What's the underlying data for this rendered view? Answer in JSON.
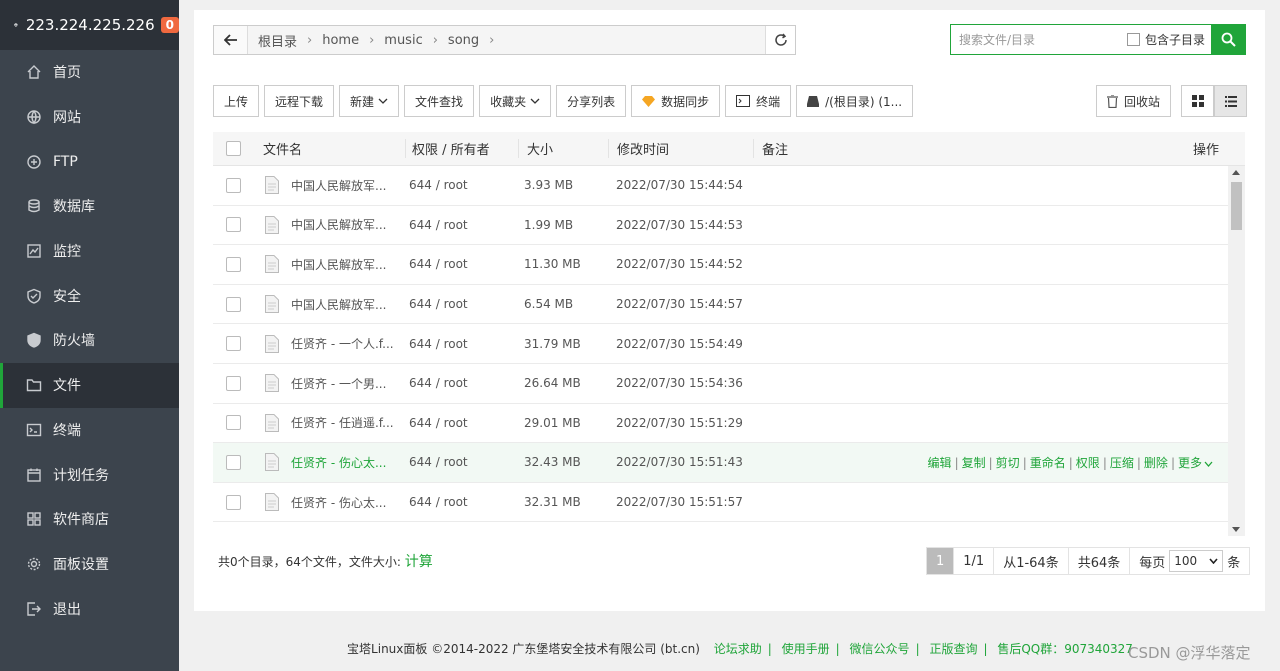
{
  "sidebar": {
    "ip": "223.224.225.226",
    "badge": "0",
    "items": [
      {
        "label": "首页",
        "icon": "home-icon"
      },
      {
        "label": "网站",
        "icon": "globe-icon"
      },
      {
        "label": "FTP",
        "icon": "ftp-icon"
      },
      {
        "label": "数据库",
        "icon": "database-icon"
      },
      {
        "label": "监控",
        "icon": "monitor-icon"
      },
      {
        "label": "安全",
        "icon": "shield-icon"
      },
      {
        "label": "防火墙",
        "icon": "firewall-icon"
      },
      {
        "label": "文件",
        "icon": "folder-icon"
      },
      {
        "label": "终端",
        "icon": "terminal-icon"
      },
      {
        "label": "计划任务",
        "icon": "calendar-icon"
      },
      {
        "label": "软件商店",
        "icon": "grid-icon"
      },
      {
        "label": "面板设置",
        "icon": "gear-icon"
      },
      {
        "label": "退出",
        "icon": "logout-icon"
      }
    ],
    "active": "文件"
  },
  "path": {
    "root": "根目录",
    "parts": [
      "home",
      "music",
      "song"
    ]
  },
  "search": {
    "placeholder": "搜索文件/目录",
    "subdir_label": "包含子目录"
  },
  "toolbar": {
    "upload": "上传",
    "remote_download": "远程下载",
    "new": "新建",
    "find": "文件查找",
    "favorites": "收藏夹",
    "share_list": "分享列表",
    "sync": "数据同步",
    "terminal": "终端",
    "disk": "/(根目录) (1...",
    "recycle": "回收站"
  },
  "table": {
    "headers": {
      "name": "文件名",
      "perm": "权限 / 所有者",
      "size": "大小",
      "mtime": "修改时间",
      "note": "备注",
      "ops": "操作"
    },
    "rows": [
      {
        "name": "中国人民解放军...",
        "perm": "644 / root",
        "size": "3.93 MB",
        "mtime": "2022/07/30 15:44:54"
      },
      {
        "name": "中国人民解放军...",
        "perm": "644 / root",
        "size": "1.99 MB",
        "mtime": "2022/07/30 15:44:53"
      },
      {
        "name": "中国人民解放军...",
        "perm": "644 / root",
        "size": "11.30 MB",
        "mtime": "2022/07/30 15:44:52"
      },
      {
        "name": "中国人民解放军...",
        "perm": "644 / root",
        "size": "6.54 MB",
        "mtime": "2022/07/30 15:44:57"
      },
      {
        "name": "任贤齐 - 一个人.f...",
        "perm": "644 / root",
        "size": "31.79 MB",
        "mtime": "2022/07/30 15:54:49"
      },
      {
        "name": "任贤齐 - 一个男...",
        "perm": "644 / root",
        "size": "26.64 MB",
        "mtime": "2022/07/30 15:54:36"
      },
      {
        "name": "任贤齐 - 任逍遥.f...",
        "perm": "644 / root",
        "size": "29.01 MB",
        "mtime": "2022/07/30 15:51:29"
      },
      {
        "name": "任贤齐 - 伤心太...",
        "perm": "644 / root",
        "size": "32.43 MB",
        "mtime": "2022/07/30 15:51:43",
        "hover": true
      },
      {
        "name": "任贤齐 - 伤心太...",
        "perm": "644 / root",
        "size": "32.31 MB",
        "mtime": "2022/07/30 15:51:57"
      }
    ],
    "ops": [
      "编辑",
      "复制",
      "剪切",
      "重命名",
      "权限",
      "压缩",
      "删除",
      "更多"
    ]
  },
  "footer": {
    "summary": "共0个目录，64个文件，文件大小:",
    "calc": "计算",
    "page": "1",
    "pages": "1/1",
    "range": "从1-64条",
    "total": "共64条",
    "per_page_label": "每页",
    "per_page": "100",
    "unit": "条"
  },
  "copyright": {
    "text": "宝塔Linux面板 ©2014-2022 广东堡塔安全技术有限公司 (bt.cn)",
    "links": [
      "论坛求助",
      "使用手册",
      "微信公众号",
      "正版查询",
      "售后QQ群：907340327"
    ]
  },
  "watermark": "CSDN @浮华落定",
  "colors": {
    "accent": "#20a53a",
    "sidebar": "#3c444d",
    "badge": "#f0693f"
  }
}
